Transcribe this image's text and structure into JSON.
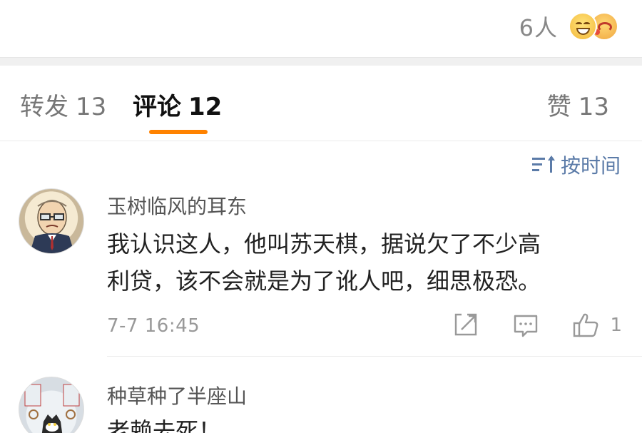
{
  "reactions": {
    "count_label": "6人",
    "emojis": [
      "grinning-face-icon",
      "laughing-crying-face-icon"
    ]
  },
  "tabs": [
    {
      "label": "转发",
      "count": "13"
    },
    {
      "label": "评论",
      "count": "12"
    },
    {
      "label": "赞",
      "count": "13"
    }
  ],
  "active_tab_color": "#ff8200",
  "sort": {
    "label": "按时间",
    "icon": "sort-icon"
  },
  "comments": [
    {
      "username": "玉树临风的耳东",
      "text_line1": "我认识这人，他叫苏天棋，据说欠了不少高",
      "text_line2": "利贷，该不会就是为了讹人吧，细思极恐。",
      "timestamp": "7-7 16:45",
      "like_count": "1",
      "actions": [
        "share-icon",
        "comment-icon",
        "thumbs-up-icon"
      ]
    },
    {
      "username": "种草种了半座山",
      "text_partial": "老赖去死！"
    }
  ]
}
